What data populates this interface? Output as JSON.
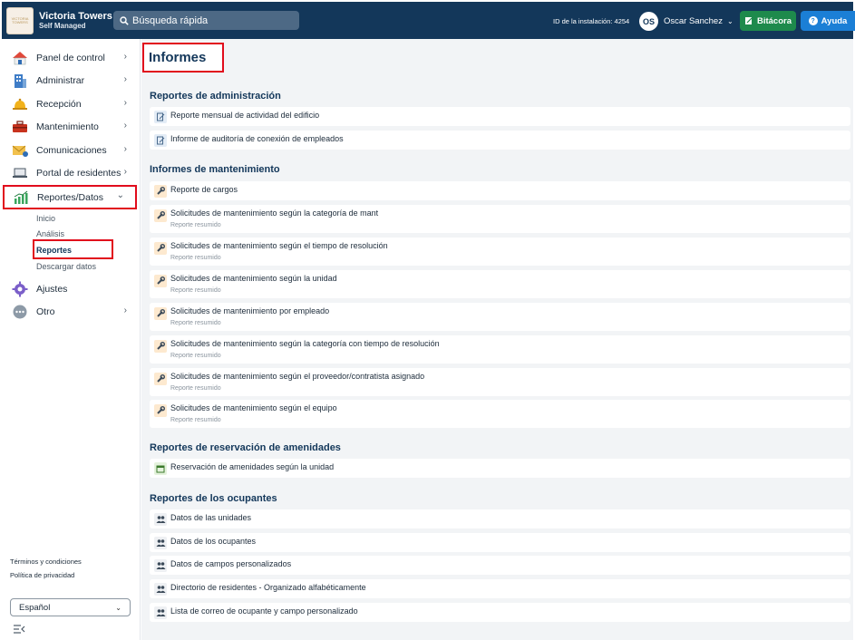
{
  "topbar": {
    "brand_name": "Victoria Towers",
    "brand_sub": "Self Managed",
    "logo_text": "VICTORIA TOWERS",
    "search_placeholder": "Búsqueda rápida",
    "install_id": "ID de la instalación: 4254",
    "user_initials": "OS",
    "user_name": "Oscar Sanchez",
    "bitacora_label": "Bitácora",
    "ayuda_label": "Ayuda"
  },
  "sidebar": {
    "items": [
      {
        "label": "Panel de control",
        "icon": "house-icon"
      },
      {
        "label": "Administrar",
        "icon": "building-icon"
      },
      {
        "label": "Recepción",
        "icon": "bell-icon"
      },
      {
        "label": "Mantenimiento",
        "icon": "toolbox-icon"
      },
      {
        "label": "Comunicaciones",
        "icon": "mail-icon"
      },
      {
        "label": "Portal de residentes",
        "icon": "laptop-icon"
      },
      {
        "label": "Reportes/Datos",
        "icon": "chart-icon"
      },
      {
        "label": "Ajustes",
        "icon": "gear-icon"
      },
      {
        "label": "Otro",
        "icon": "more-icon"
      }
    ],
    "sub_items": [
      "Inicio",
      "Análisis",
      "Reportes",
      "Descargar datos"
    ],
    "terms": "Términos y condiciones",
    "privacy": "Política de privacidad",
    "language": "Español"
  },
  "main": {
    "title": "Informes",
    "sections": [
      {
        "title": "Reportes de administración",
        "rows": [
          {
            "label": "Reporte mensual de actividad del edificio",
            "sub": ""
          },
          {
            "label": "Informe de auditoría de conexión de empleados",
            "sub": ""
          }
        ]
      },
      {
        "title": "Informes de mantenimiento",
        "rows": [
          {
            "label": "Reporte de cargos",
            "sub": ""
          },
          {
            "label": "Solicitudes de mantenimiento según la categoría de mant",
            "sub": "Reporte resumido"
          },
          {
            "label": "Solicitudes de mantenimiento según el tiempo de resolución",
            "sub": "Reporte resumido"
          },
          {
            "label": "Solicitudes de mantenimiento según la unidad",
            "sub": "Reporte resumido"
          },
          {
            "label": "Solicitudes de mantenimiento por empleado",
            "sub": "Reporte resumido"
          },
          {
            "label": "Solicitudes de mantenimiento según la categoría con tiempo de resolución",
            "sub": "Reporte resumido"
          },
          {
            "label": "Solicitudes de mantenimiento según el proveedor/contratista asignado",
            "sub": "Reporte resumido"
          },
          {
            "label": "Solicitudes de mantenimiento según el equipo",
            "sub": "Reporte resumido"
          }
        ]
      },
      {
        "title": "Reportes de reservación de amenidades",
        "rows": [
          {
            "label": "Reservación de amenidades según la unidad",
            "sub": ""
          }
        ]
      },
      {
        "title": "Reportes de los ocupantes",
        "rows": [
          {
            "label": "Datos de las unidades",
            "sub": ""
          },
          {
            "label": "Datos de los ocupantes",
            "sub": ""
          },
          {
            "label": "Datos de campos personalizados",
            "sub": ""
          },
          {
            "label": "Directorio de residentes - Organizado alfabéticamente",
            "sub": ""
          },
          {
            "label": "Lista de correo de ocupante y campo personalizado",
            "sub": ""
          }
        ]
      }
    ]
  }
}
